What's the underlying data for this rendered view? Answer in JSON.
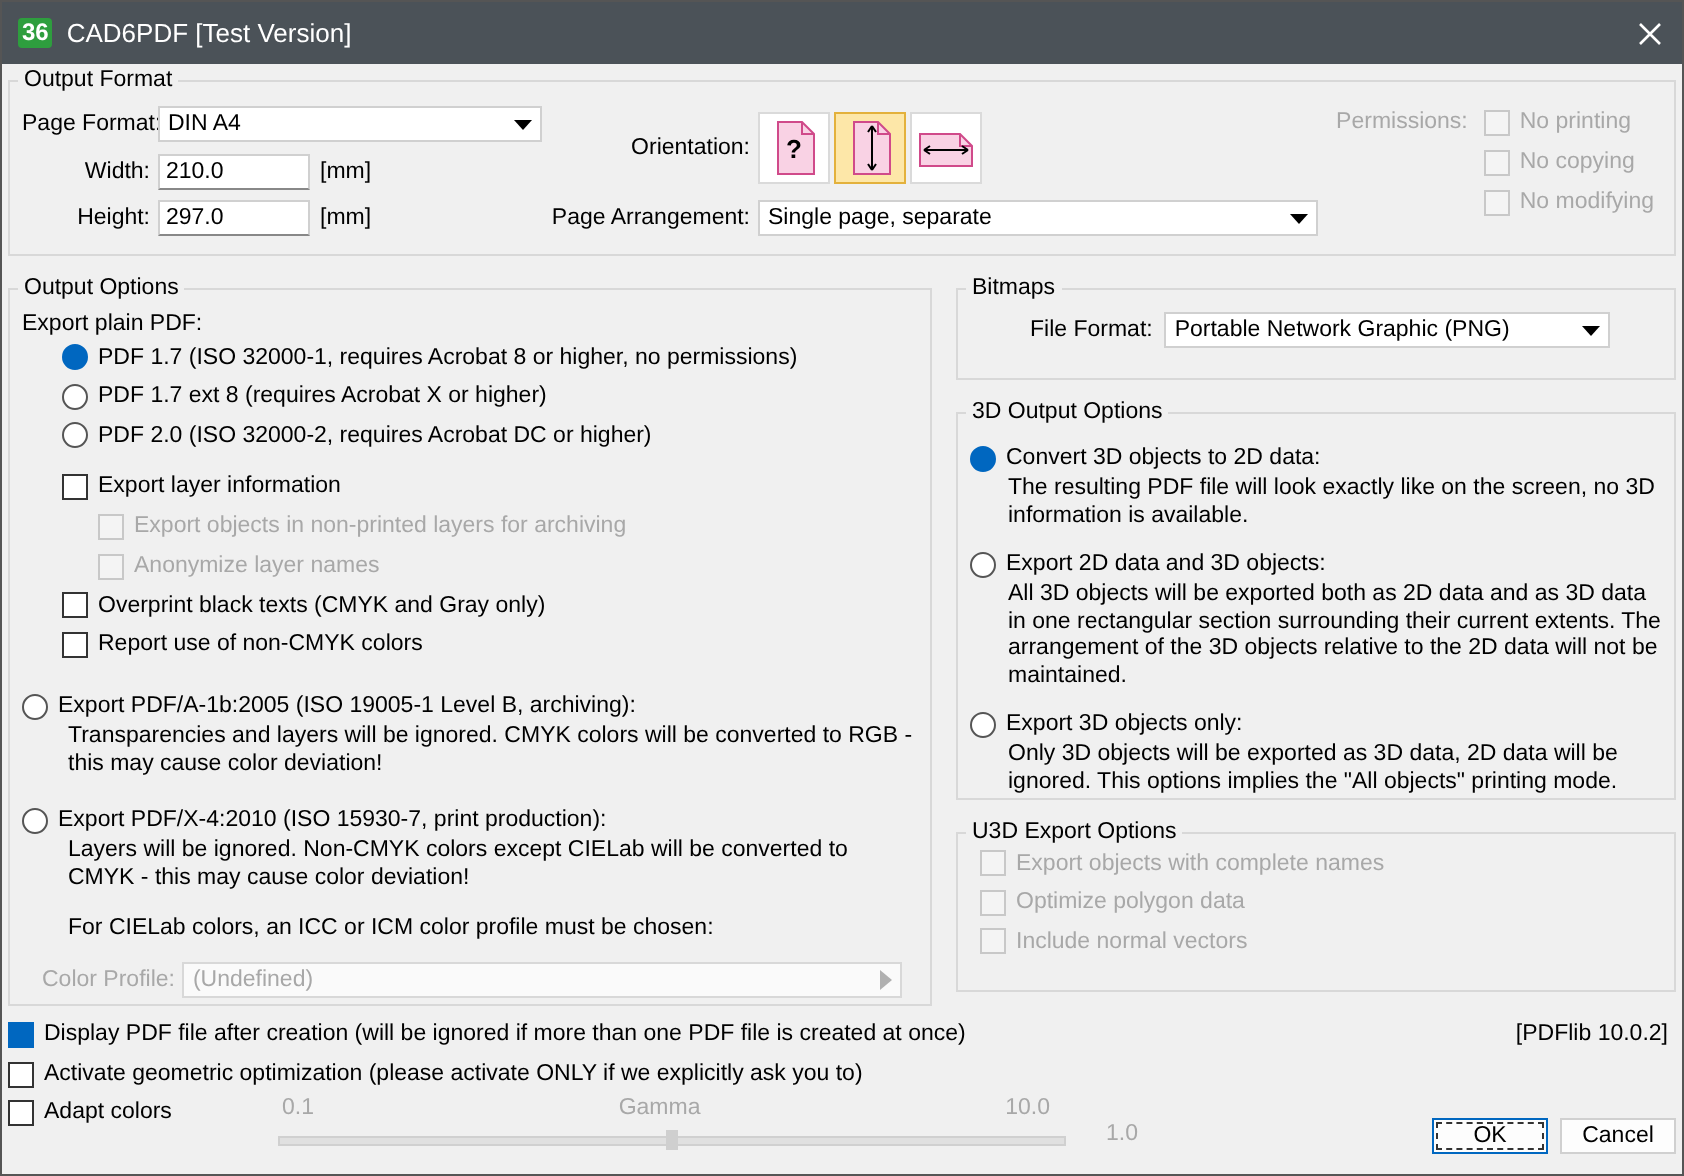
{
  "window": {
    "title": "CAD6PDF [Test Version]",
    "logo": "36"
  },
  "output_format": {
    "title": "Output Format",
    "page_format": {
      "label": "Page Format:",
      "value": "DIN A4"
    },
    "width": {
      "label": "Width:",
      "value": "210.0",
      "unit": "[mm]"
    },
    "height": {
      "label": "Height:",
      "value": "297.0",
      "unit": "[mm]"
    },
    "orientation": {
      "label": "Orientation:",
      "options": [
        {
          "kind": "unknown",
          "glyph": "?",
          "selected": false
        },
        {
          "kind": "portrait",
          "selected": true
        },
        {
          "kind": "landscape",
          "selected": false
        }
      ]
    },
    "page_arrangement": {
      "label": "Page Arrangement:",
      "value": "Single page, separate"
    },
    "permissions": {
      "label": "Permissions:",
      "disabled": true,
      "items": [
        {
          "label": "No printing",
          "checked": false,
          "disabled": true
        },
        {
          "label": "No copying",
          "checked": false,
          "disabled": true
        },
        {
          "label": "No modifying",
          "checked": false,
          "disabled": true
        }
      ]
    }
  },
  "output_options": {
    "title": "Output Options",
    "plain_label": "Export plain PDF:",
    "versions": [
      {
        "label": "PDF 1.7 (ISO 32000-1, requires Acrobat 8 or higher, no permissions)",
        "selected": true
      },
      {
        "label": "PDF 1.7 ext 8 (requires Acrobat X or higher)",
        "selected": false
      },
      {
        "label": "PDF 2.0 (ISO 32000-2, requires Acrobat DC or higher)",
        "selected": false
      }
    ],
    "checks": [
      {
        "label": "Export layer information",
        "checked": false,
        "disabled": false,
        "children": [
          {
            "label": "Export objects in non-printed layers for archiving",
            "checked": false,
            "disabled": true
          },
          {
            "label": "Anonymize layer names",
            "checked": false,
            "disabled": true
          }
        ]
      },
      {
        "label": "Overprint black texts (CMYK and Gray only)",
        "checked": false,
        "disabled": false
      },
      {
        "label": "Report use of non-CMYK colors",
        "checked": false,
        "disabled": false
      }
    ],
    "standards": [
      {
        "label": "Export PDF/A-1b:2005 (ISO 19005-1 Level B, archiving):",
        "description": "Transparencies and layers will be ignored. CMYK colors will be converted to RGB - this may cause color deviation!",
        "selected": false
      },
      {
        "label": "Export PDF/X-4:2010 (ISO 15930-7, print production):",
        "description": "Layers will be ignored. Non-CMYK colors except CIELab will be converted to CMYK - this may cause color deviation!",
        "selected": false
      }
    ],
    "note": "For CIELab colors, an ICC or ICM color profile must be chosen:",
    "color_profile": {
      "label": "Color Profile:",
      "value": "(Undefined)",
      "disabled": true
    }
  },
  "bitmaps": {
    "title": "Bitmaps",
    "file_format": {
      "label": "File Format:",
      "value": "Portable Network Graphic (PNG)"
    }
  },
  "output_3d": {
    "title": "3D Output Options",
    "options": [
      {
        "label": "Convert 3D objects to 2D data:",
        "description": "The resulting PDF file will look exactly like on the screen, no 3D information is available.",
        "selected": true
      },
      {
        "label": "Export 2D data and 3D objects:",
        "description": "All 3D objects will be exported both as 2D data and as 3D data in one rectangular section surrounding their current extents. The arrangement of the 3D objects relative to the 2D data will not be maintained.",
        "selected": false
      },
      {
        "label": "Export 3D objects only:",
        "description": "Only 3D objects will be exported as 3D data, 2D data will be ignored. This options implies the \"All objects\" printing mode.",
        "selected": false
      }
    ]
  },
  "u3d": {
    "title": "U3D Export Options",
    "items": [
      {
        "label": "Export objects with complete names",
        "checked": false,
        "disabled": true
      },
      {
        "label": "Optimize polygon data",
        "checked": false,
        "disabled": true
      },
      {
        "label": "Include normal vectors",
        "checked": false,
        "disabled": true
      }
    ]
  },
  "bottom_checks": [
    {
      "label": "Display PDF file after creation (will be ignored if more than one PDF file is created at once)",
      "checked": true
    },
    {
      "label": "Activate geometric optimization (please activate ONLY if we explicitly ask you to)",
      "checked": false
    },
    {
      "label": "Adapt colors",
      "checked": false
    }
  ],
  "gamma": {
    "min": "0.1",
    "label": "Gamma",
    "max": "10.0",
    "value": "1.0",
    "level": 0.5,
    "disabled": true
  },
  "version": "[PDFlib 10.0.2]",
  "buttons": [
    {
      "label": "OK",
      "default": true
    },
    {
      "label": "Cancel",
      "default": false
    }
  ]
}
